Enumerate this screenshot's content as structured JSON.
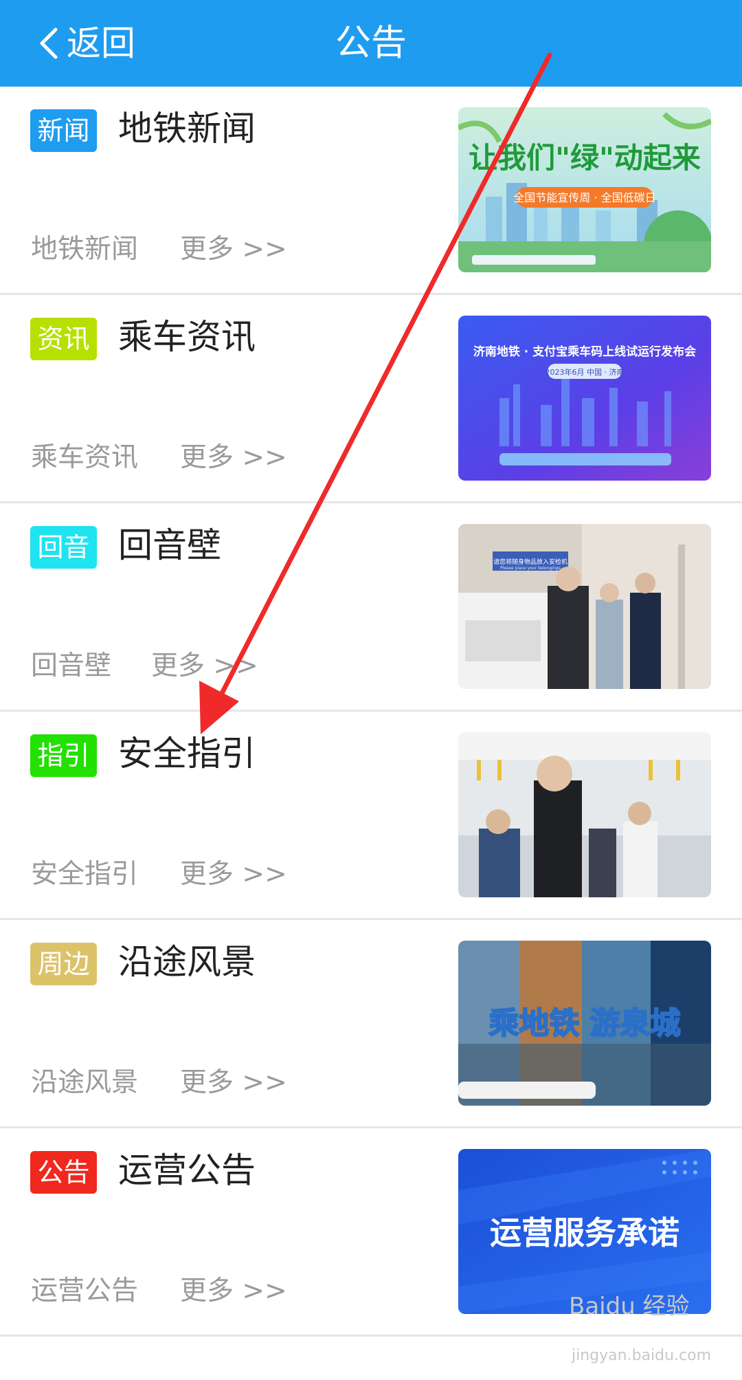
{
  "header": {
    "back_label": "返回",
    "title": "公告",
    "background": "#1e9cf0"
  },
  "rows": [
    {
      "tag": "新闻",
      "tag_color": "#1e9cf0",
      "title": "地铁新闻",
      "subtitle": "地铁新闻",
      "more": "更多 >>",
      "thumb": {
        "text": "让我们\"绿\"动起来",
        "subtext": "全国节能宣传周 · 全国低碳日"
      }
    },
    {
      "tag": "资讯",
      "tag_color": "#b7e000",
      "title": "乘车资讯",
      "subtitle": "乘车资讯",
      "more": "更多 >>",
      "thumb": {
        "text": "济南地铁 · 支付宝乘车码上线试运行发布会",
        "subtext": "2023年6月  中国 · 济南"
      }
    },
    {
      "tag": "回音",
      "tag_color": "#1fe3f0",
      "title": "回音壁",
      "subtitle": "回音壁",
      "more": "更多 >>",
      "thumb": {
        "text": "请您将随身物品放入安检机",
        "subtext": "Please place your belongings"
      }
    },
    {
      "tag": "指引",
      "tag_color": "#22e000",
      "title": "安全指引",
      "subtitle": "安全指引",
      "more": "更多 >>",
      "thumb": {
        "text": "",
        "subtext": ""
      }
    },
    {
      "tag": "周边",
      "tag_color": "#dcc36a",
      "title": "沿途风景",
      "subtitle": "沿途风景",
      "more": "更多 >>",
      "thumb": {
        "text": "乘地铁  游泉城",
        "subtext": ""
      }
    },
    {
      "tag": "公告",
      "tag_color": "#f0281e",
      "title": "运营公告",
      "subtitle": "运营公告",
      "more": "更多 >>",
      "thumb": {
        "text": "运营服务承诺",
        "subtext": ""
      }
    }
  ],
  "annotation_color": "#f02a2a",
  "watermark": {
    "text": "Baidu 经验",
    "subtext": "jingyan.baidu.com"
  }
}
